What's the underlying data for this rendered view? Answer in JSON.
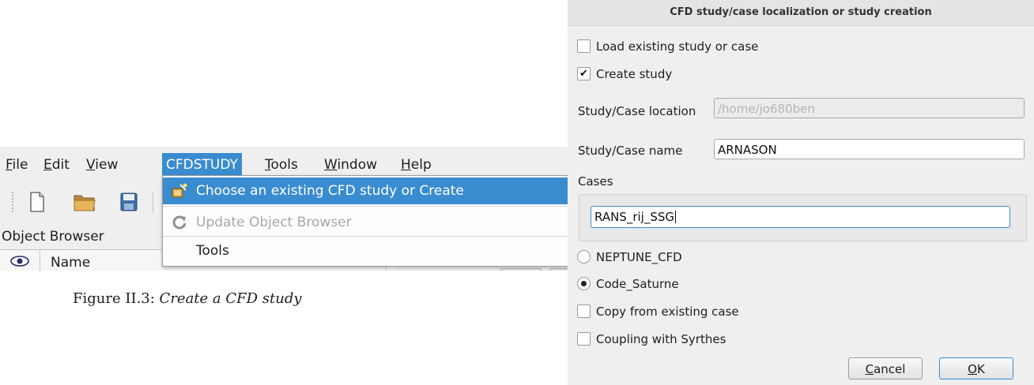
{
  "menubar": {
    "items": [
      {
        "key": "F",
        "rest": "ile"
      },
      {
        "key": "E",
        "rest": "dit"
      },
      {
        "key": "V",
        "rest": "iew"
      },
      {
        "key": "",
        "rest": "CFDSTUDY"
      },
      {
        "key": "T",
        "rest": "ools"
      },
      {
        "key": "W",
        "rest": "indow"
      },
      {
        "key": "H",
        "rest": "elp"
      }
    ]
  },
  "dropdown": {
    "choose": "Choose an existing CFD study or Create",
    "update": "Update Object Browser",
    "tools": "Tools"
  },
  "object_browser": {
    "title": "Object Browser",
    "name_header": "Name"
  },
  "caption": {
    "prefix": "Figure II.3:",
    "text": "Create a CFD study"
  },
  "dialog": {
    "title": "CFD study/case localization or study creation",
    "load_existing": {
      "label": "Load existing study or case",
      "checked": false
    },
    "create_study": {
      "label": "Create study",
      "checked": true
    },
    "location_label": "Study/Case location",
    "location_value": "/home/jo680ben",
    "name_label": "Study/Case name",
    "name_value": "ARNASON",
    "cases_label": "Cases",
    "cases_value": "RANS_rij_SSG",
    "neptune": {
      "label": "NEPTUNE_CFD",
      "selected": false
    },
    "saturne": {
      "label": "Code_Saturne",
      "selected": true
    },
    "copy_existing": {
      "label": "Copy from existing case",
      "checked": false
    },
    "coupling": {
      "label": "Coupling with Syrthes",
      "checked": false
    },
    "cancel_key": "C",
    "cancel_rest": "ancel",
    "ok_key": "O",
    "ok_rest": "K",
    "check_mark": "✔"
  },
  "colors": {
    "accent": "#3a8cd0",
    "disabled_text": "#a7a7a7"
  }
}
